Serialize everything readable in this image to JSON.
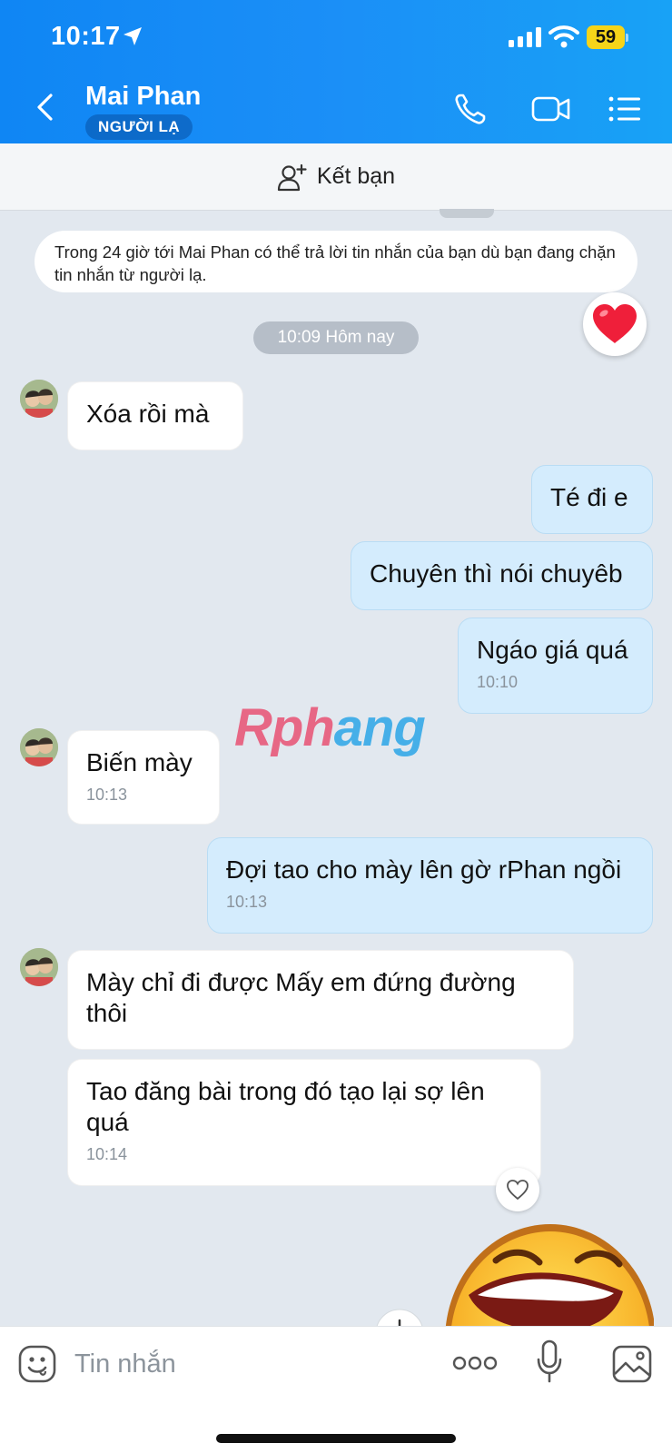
{
  "status_bar": {
    "time": "10:17",
    "battery": "59"
  },
  "header": {
    "contact_name": "Mai Phan",
    "badge": "NGƯỜI LẠ"
  },
  "add_friend": {
    "label": "Kết bạn"
  },
  "notice": {
    "text": "Trong 24 giờ tới Mai Phan có thể trả lời tin nhắn của bạn dù bạn đang chặn tin nhắn từ người lạ."
  },
  "timestamp_chip": "10:09 Hôm nay",
  "messages": [
    {
      "side": "in",
      "text": "Xóa  rồi mà",
      "time": ""
    },
    {
      "side": "out",
      "text": "Té đi e",
      "time": ""
    },
    {
      "side": "out",
      "text": "Chuyên thì nói chuyêb",
      "time": ""
    },
    {
      "side": "out",
      "text": "Ngáo giá quá",
      "time": "10:10"
    },
    {
      "side": "in",
      "text": "Biến mày",
      "time": "10:13"
    },
    {
      "side": "out",
      "text": "Đợi tao cho mày lên gờ rPhan ngồi",
      "time": "10:13"
    },
    {
      "side": "in",
      "text": "Mày  chỉ  đi được  Mấy em đứng đường thôi",
      "time": ""
    },
    {
      "side": "in",
      "text": "Tao đăng  bài  trong đó tạo lại sợ lên quá",
      "time": "10:14"
    }
  ],
  "watermark": {
    "part1": "Rph",
    "part2": "ang"
  },
  "input": {
    "placeholder": "Tin nhắn"
  },
  "icons": {
    "back": "chevron-left-icon",
    "call": "phone-icon",
    "video": "video-camera-icon",
    "menu": "list-icon",
    "add_friend": "add-user-icon",
    "heart": "heart-icon",
    "emoji": "emoji-icon",
    "more": "more-icon",
    "mic": "microphone-icon",
    "image": "image-icon"
  },
  "colors": {
    "header": "#1b8ff7",
    "outgoing_bubble": "#d4ecfd",
    "incoming_bubble": "#ffffff",
    "background": "#e2e8ef",
    "battery": "#f5d419"
  }
}
